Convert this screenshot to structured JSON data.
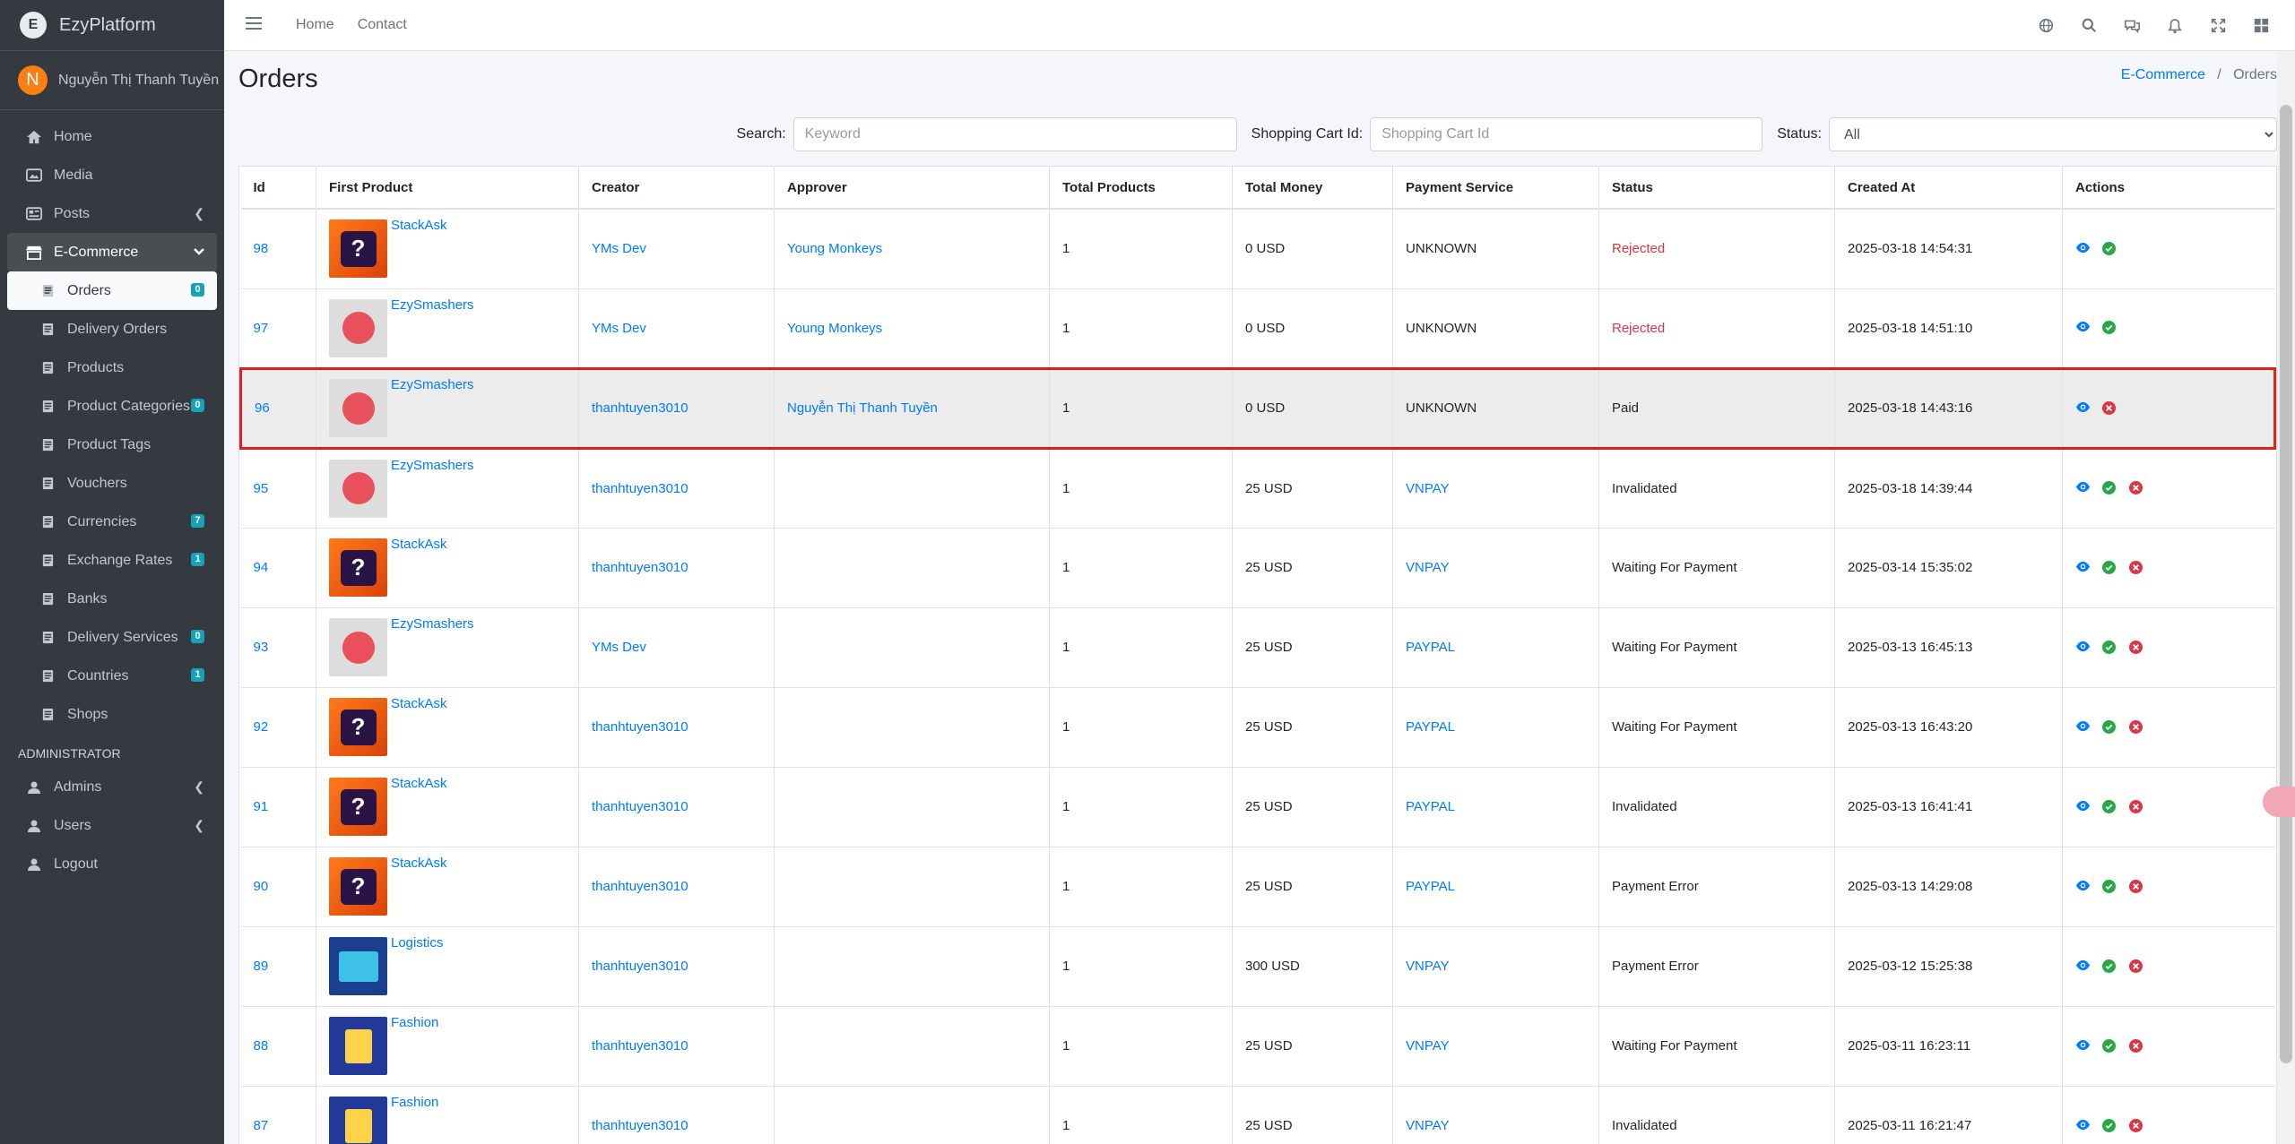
{
  "brand": {
    "name": "EzyPlatform",
    "logo_initial": "E"
  },
  "user": {
    "name": "Nguyễn Thị Thanh Tuyền",
    "initial": "N"
  },
  "sidebar": {
    "items": [
      {
        "label": "Home",
        "icon": "home-icon"
      },
      {
        "label": "Media",
        "icon": "image-icon"
      },
      {
        "label": "Posts",
        "icon": "newspaper-icon"
      },
      {
        "label": "E-Commerce",
        "icon": "store-icon"
      }
    ],
    "ecommerce_sub": [
      {
        "label": "Orders",
        "badge": "0"
      },
      {
        "label": "Delivery Orders",
        "badge": ""
      },
      {
        "label": "Products",
        "badge": ""
      },
      {
        "label": "Product Categories",
        "badge": "0"
      },
      {
        "label": "Product Tags",
        "badge": ""
      },
      {
        "label": "Vouchers",
        "badge": ""
      },
      {
        "label": "Currencies",
        "badge": "7"
      },
      {
        "label": "Exchange Rates",
        "badge": "1"
      },
      {
        "label": "Banks",
        "badge": ""
      },
      {
        "label": "Delivery Services",
        "badge": "0"
      },
      {
        "label": "Countries",
        "badge": "1"
      },
      {
        "label": "Shops",
        "badge": ""
      }
    ],
    "admin_header": "ADMINISTRATOR",
    "admin_items": [
      {
        "label": "Admins"
      },
      {
        "label": "Users"
      },
      {
        "label": "Logout"
      }
    ]
  },
  "topbar": {
    "links": [
      "Home",
      "Contact"
    ]
  },
  "page": {
    "title": "Orders",
    "breadcrumb_parent": "E-Commerce",
    "breadcrumb_current": "Orders"
  },
  "filters": {
    "search_label": "Search:",
    "search_placeholder": "Keyword",
    "cart_label": "Shopping Cart Id:",
    "cart_placeholder": "Shopping Cart Id",
    "status_label": "Status:",
    "status_value": "All"
  },
  "table": {
    "headers": [
      "Id",
      "First Product",
      "Creator",
      "Approver",
      "Total Products",
      "Total Money",
      "Payment Service",
      "Status",
      "Created At",
      "Actions"
    ],
    "rows": [
      {
        "id": "98",
        "product": "StackAsk",
        "thumb": "stack",
        "creator": "YMs Dev",
        "approver": "Young Monkeys",
        "total_products": "1",
        "total_money": "0 USD",
        "payment": "UNKNOWN",
        "status": "Rejected",
        "created": "2025-03-18 14:54:31",
        "actions": [
          "view",
          "approve"
        ]
      },
      {
        "id": "97",
        "product": "EzySmashers",
        "thumb": "ezy",
        "creator": "YMs Dev",
        "approver": "Young Monkeys",
        "total_products": "1",
        "total_money": "0 USD",
        "payment": "UNKNOWN",
        "status": "Rejected",
        "created": "2025-03-18 14:51:10",
        "actions": [
          "view",
          "approve"
        ]
      },
      {
        "id": "96",
        "product": "EzySmashers",
        "thumb": "ezy",
        "creator": "thanhtuyen3010",
        "approver": "Nguyễn Thị Thanh Tuyền",
        "total_products": "1",
        "total_money": "0 USD",
        "payment": "UNKNOWN",
        "status": "Paid",
        "created": "2025-03-18 14:43:16",
        "actions": [
          "view",
          "reject"
        ]
      },
      {
        "id": "95",
        "product": "EzySmashers",
        "thumb": "ezy",
        "creator": "thanhtuyen3010",
        "approver": "",
        "total_products": "1",
        "total_money": "25 USD",
        "payment": "VNPAY",
        "status": "Invalidated",
        "created": "2025-03-18 14:39:44",
        "actions": [
          "view",
          "approve",
          "reject"
        ]
      },
      {
        "id": "94",
        "product": "StackAsk",
        "thumb": "stack",
        "creator": "thanhtuyen3010",
        "approver": "",
        "total_products": "1",
        "total_money": "25 USD",
        "payment": "VNPAY",
        "status": "Waiting For Payment",
        "created": "2025-03-14 15:35:02",
        "actions": [
          "view",
          "approve",
          "reject"
        ]
      },
      {
        "id": "93",
        "product": "EzySmashers",
        "thumb": "ezy",
        "creator": "YMs Dev",
        "approver": "",
        "total_products": "1",
        "total_money": "25 USD",
        "payment": "PAYPAL",
        "status": "Waiting For Payment",
        "created": "2025-03-13 16:45:13",
        "actions": [
          "view",
          "approve",
          "reject"
        ]
      },
      {
        "id": "92",
        "product": "StackAsk",
        "thumb": "stack",
        "creator": "thanhtuyen3010",
        "approver": "",
        "total_products": "1",
        "total_money": "25 USD",
        "payment": "PAYPAL",
        "status": "Waiting For Payment",
        "created": "2025-03-13 16:43:20",
        "actions": [
          "view",
          "approve",
          "reject"
        ]
      },
      {
        "id": "91",
        "product": "StackAsk",
        "thumb": "stack",
        "creator": "thanhtuyen3010",
        "approver": "",
        "total_products": "1",
        "total_money": "25 USD",
        "payment": "PAYPAL",
        "status": "Invalidated",
        "created": "2025-03-13 16:41:41",
        "actions": [
          "view",
          "approve",
          "reject"
        ]
      },
      {
        "id": "90",
        "product": "StackAsk",
        "thumb": "stack",
        "creator": "thanhtuyen3010",
        "approver": "",
        "total_products": "1",
        "total_money": "25 USD",
        "payment": "PAYPAL",
        "status": "Payment Error",
        "created": "2025-03-13 14:29:08",
        "actions": [
          "view",
          "approve",
          "reject"
        ]
      },
      {
        "id": "89",
        "product": "Logistics",
        "thumb": "logi",
        "creator": "thanhtuyen3010",
        "approver": "",
        "total_products": "1",
        "total_money": "300 USD",
        "payment": "VNPAY",
        "status": "Payment Error",
        "created": "2025-03-12 15:25:38",
        "actions": [
          "view",
          "approve",
          "reject"
        ]
      },
      {
        "id": "88",
        "product": "Fashion",
        "thumb": "fash",
        "creator": "thanhtuyen3010",
        "approver": "",
        "total_products": "1",
        "total_money": "25 USD",
        "payment": "VNPAY",
        "status": "Waiting For Payment",
        "created": "2025-03-11 16:23:11",
        "actions": [
          "view",
          "approve",
          "reject"
        ]
      },
      {
        "id": "87",
        "product": "Fashion",
        "thumb": "fash",
        "creator": "thanhtuyen3010",
        "approver": "",
        "total_products": "1",
        "total_money": "25 USD",
        "payment": "VNPAY",
        "status": "Invalidated",
        "created": "2025-03-11 16:21:47",
        "actions": [
          "view",
          "approve",
          "reject"
        ]
      }
    ],
    "highlighted_row_id": "96"
  },
  "colors": {
    "link": "#007bff",
    "rejected": "#dc3545",
    "highlight_border": "#e0201f",
    "view": "#007bff",
    "approve": "#28a745",
    "reject": "#dc3545"
  }
}
